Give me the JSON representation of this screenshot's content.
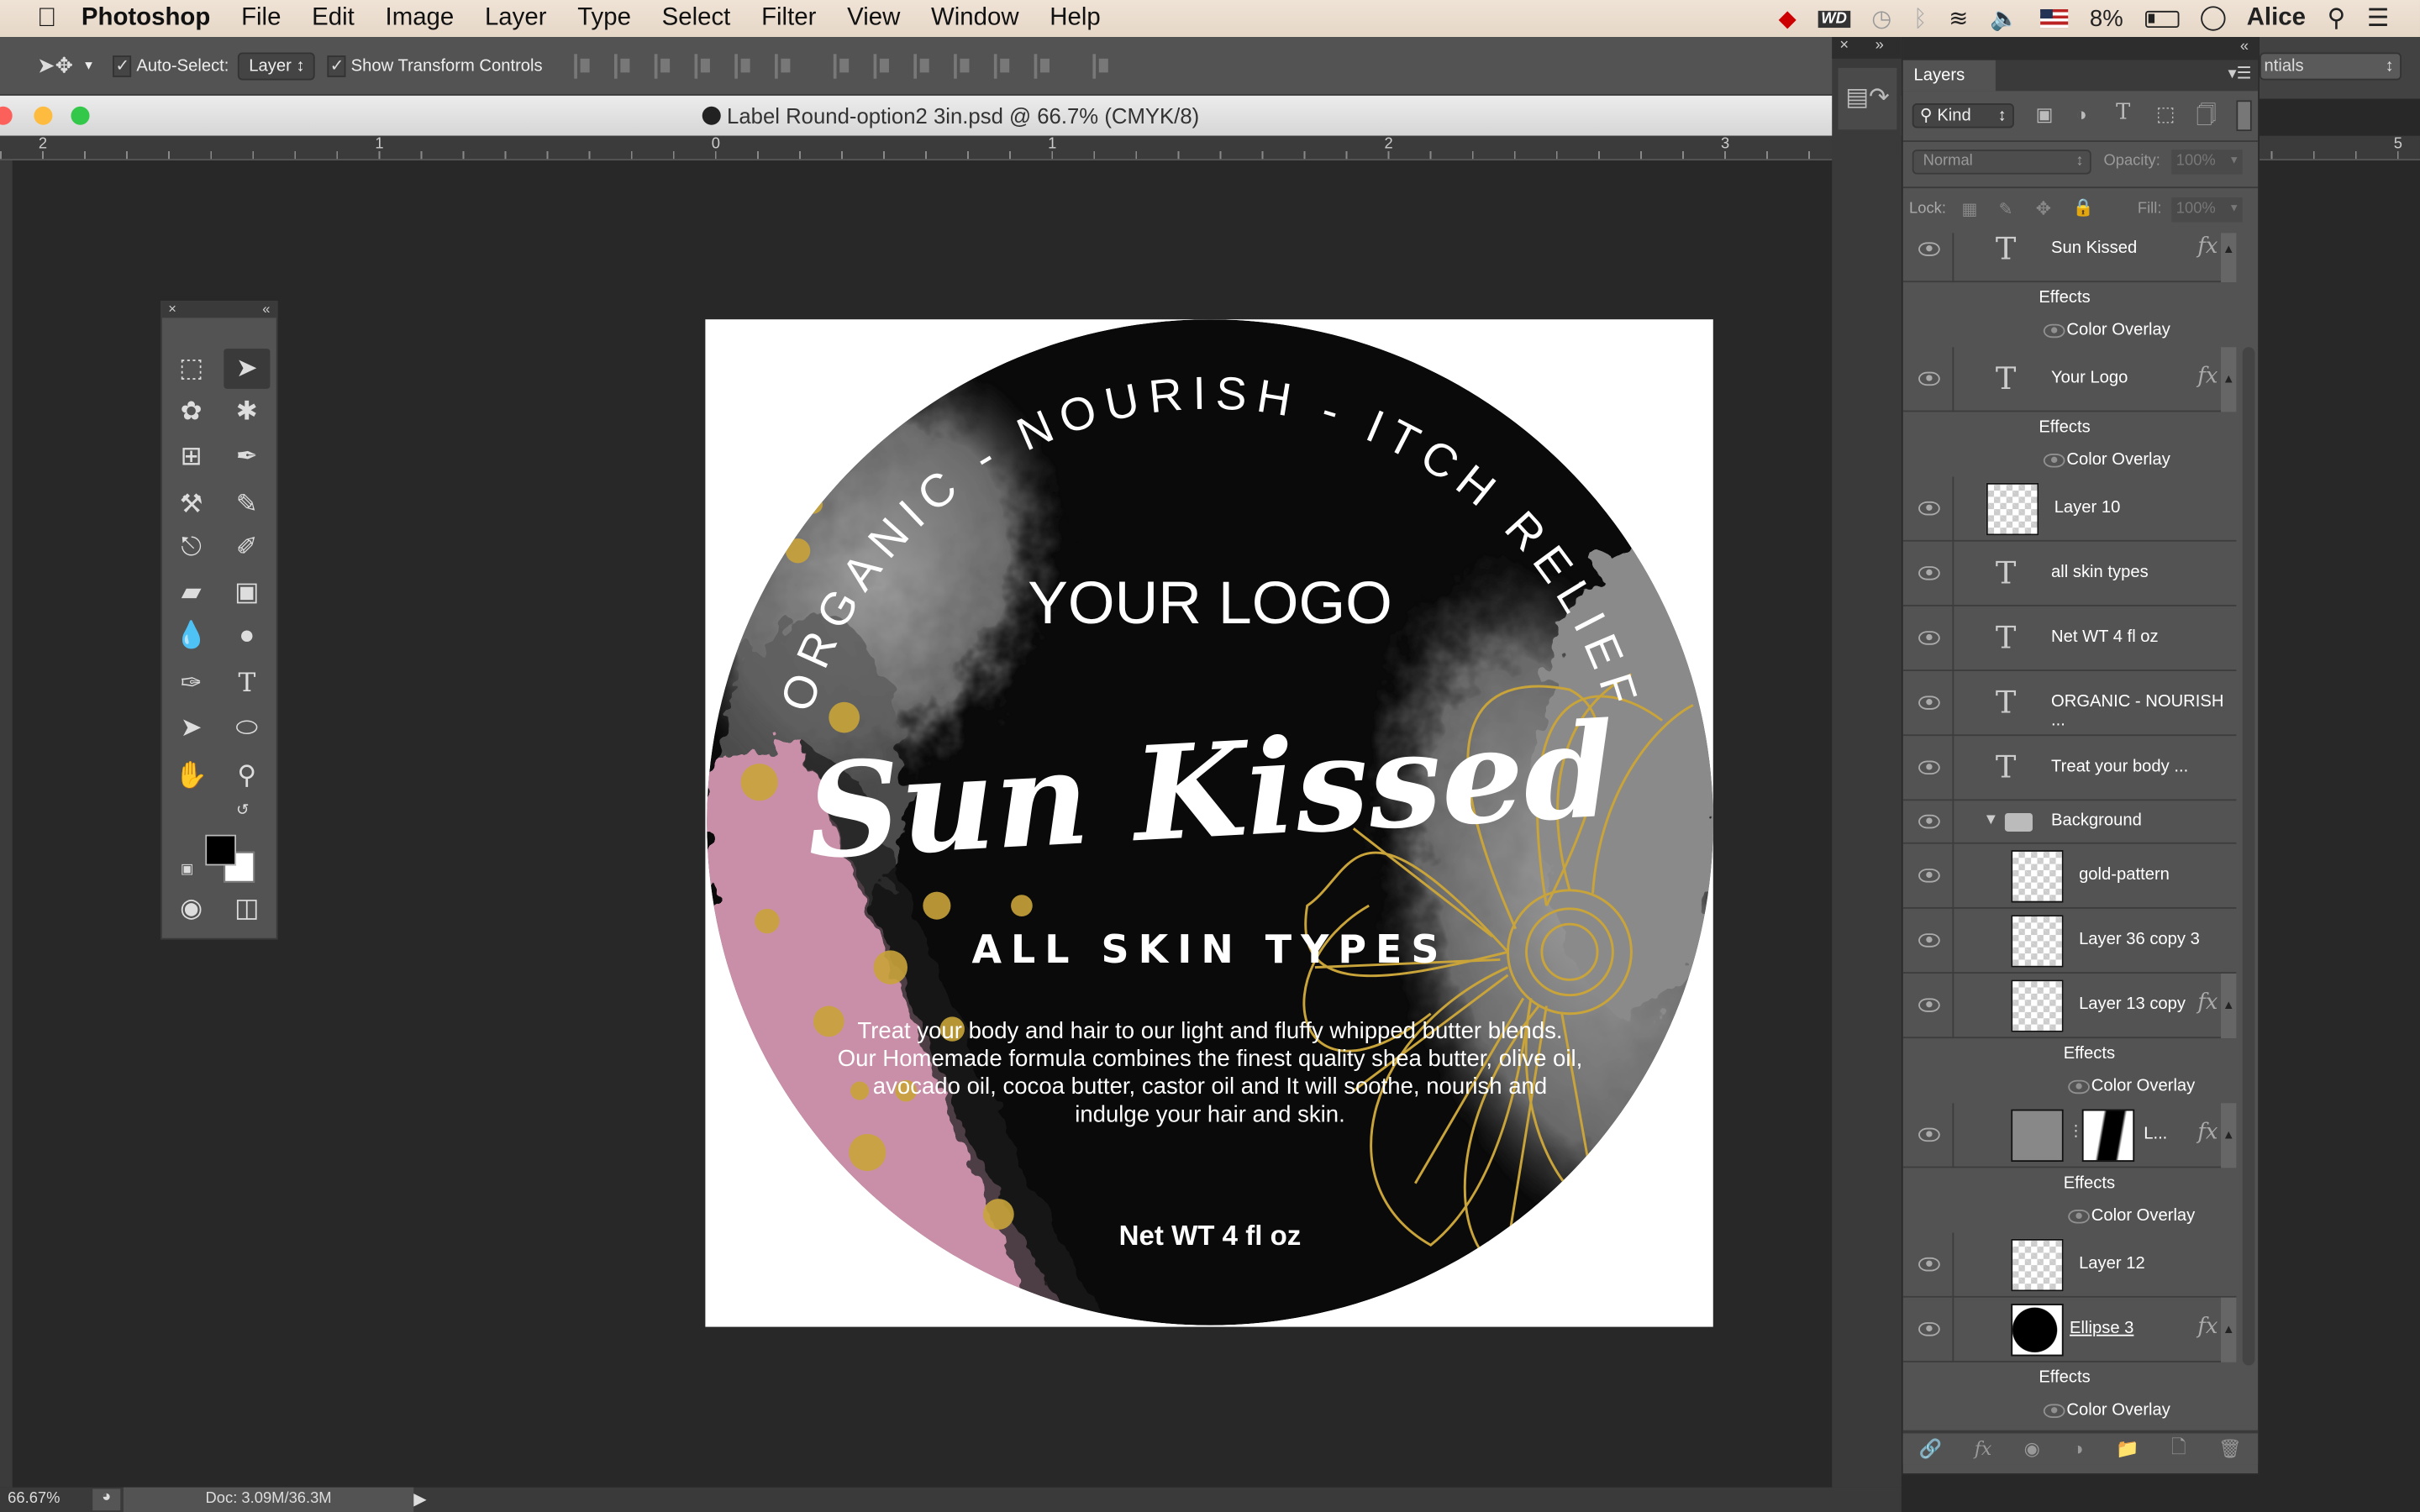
{
  "menubar": {
    "app": "Photoshop",
    "items": [
      "File",
      "Edit",
      "Image",
      "Layer",
      "Type",
      "Select",
      "Filter",
      "View",
      "Window",
      "Help"
    ],
    "battery": "8%",
    "user": "Alice"
  },
  "options": {
    "auto_select_label": "Auto-Select:",
    "auto_select_checked": true,
    "auto_select_value": "Layer",
    "show_transform_label": "Show Transform Controls",
    "show_transform_checked": true,
    "workspace": "ntials"
  },
  "document": {
    "title": "Label Round-option2 3in.psd @ 66.7% (CMYK/8)"
  },
  "ruler": {
    "labels": [
      "2",
      "1",
      "0",
      "1",
      "2",
      "3",
      "5"
    ]
  },
  "status": {
    "zoom": "66.67%",
    "doc": "Doc: 3.09M/36.3M"
  },
  "artwork": {
    "arc_text": "ORGANIC - NOURISH - ITCH RELIEF",
    "logo": "YOUR LOGO",
    "name": "Sun Kissed",
    "subtitle": "ALL SKIN TYPES",
    "body": [
      "Treat your body and hair to our light and fluffy whipped butter blends.",
      "Our Homemade formula combines the finest quality shea butter, olive oil,",
      "avocado oil, cocoa butter, castor oil and It will soothe, nourish and",
      "indulge your hair and skin."
    ],
    "net": "Net WT 4 fl oz",
    "colors": {
      "gold": "#c9a43a",
      "pink": "#c98fa8",
      "black": "#0a0a0a"
    }
  },
  "layers_panel": {
    "tab": "Layers",
    "filter": "Kind",
    "blend": "Normal",
    "opacity_label": "Opacity:",
    "opacity": "100%",
    "lock_label": "Lock:",
    "fill_label": "Fill:",
    "fill": "100%",
    "layers": [
      {
        "name": "Sun Kissed",
        "type": "text",
        "fx": true
      },
      {
        "name": "Effects",
        "type": "effects"
      },
      {
        "name": "Color Overlay",
        "type": "effect"
      },
      {
        "name": "Your Logo",
        "type": "text",
        "fx": true
      },
      {
        "name": "Effects",
        "type": "effects"
      },
      {
        "name": "Color Overlay",
        "type": "effect"
      },
      {
        "name": "Layer 10",
        "type": "pixel"
      },
      {
        "name": "all skin types",
        "type": "text"
      },
      {
        "name": "Net WT 4 fl oz",
        "type": "text"
      },
      {
        "name": "ORGANIC - NOURISH ...",
        "type": "text"
      },
      {
        "name": "Treat your body ...",
        "type": "text"
      },
      {
        "name": "Background",
        "type": "group"
      },
      {
        "name": "gold-pattern",
        "type": "pixel",
        "clip": true,
        "indent": true
      },
      {
        "name": "Layer 36 copy 3",
        "type": "pixel",
        "clip": true,
        "indent": true
      },
      {
        "name": "Layer 13 copy",
        "type": "pixel",
        "clip": true,
        "indent": true,
        "fx": true
      },
      {
        "name": "Effects",
        "type": "effects",
        "indent": true
      },
      {
        "name": "Color Overlay",
        "type": "effect",
        "indent": true
      },
      {
        "name": "L...",
        "type": "masked",
        "clip": true,
        "indent": true,
        "fx": true
      },
      {
        "name": "Effects",
        "type": "effects",
        "indent": true
      },
      {
        "name": "Color Overlay",
        "type": "effect",
        "indent": true
      },
      {
        "name": "Layer 12",
        "type": "pixel",
        "clip": true,
        "indent": true
      },
      {
        "name": "Ellipse 3",
        "type": "shape",
        "fx": true
      },
      {
        "name": "Effects",
        "type": "effects"
      },
      {
        "name": "Color Overlay",
        "type": "effect"
      }
    ]
  }
}
